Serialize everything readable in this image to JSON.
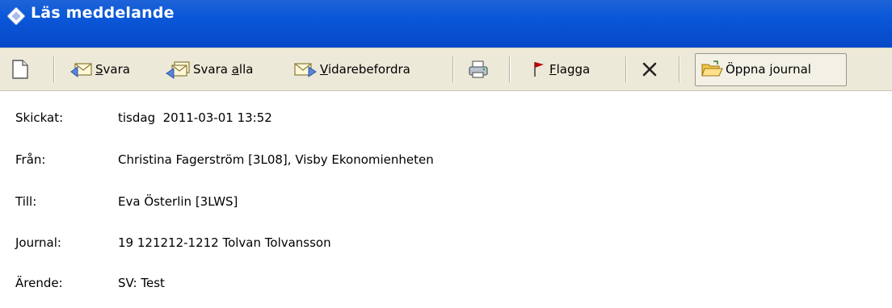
{
  "window": {
    "title": "Läs meddelande"
  },
  "toolbar": {
    "reply": {
      "underline": "S",
      "rest": "vara"
    },
    "reply_all": {
      "pre": "Svara ",
      "underline": "a",
      "rest": "lla"
    },
    "forward": {
      "underline": "V",
      "rest": "idarebefordra"
    },
    "flag": {
      "underline": "F",
      "rest": "lagga"
    },
    "open_journal": "Öppna journal"
  },
  "fields": [
    {
      "label": "Skickat:",
      "value": "tisdag  2011-03-01 13:52"
    },
    {
      "label": "Från:",
      "value": "Christina Fagerström [3L08], Visby Ekonomienheten"
    },
    {
      "label": "Till:",
      "value": "Eva Österlin [3LWS]"
    },
    {
      "label": "Journal:",
      "value": "19 121212-1212 Tolvan Tolvansson"
    },
    {
      "label": "Ärende:",
      "value": "SV: Test"
    }
  ],
  "colors": {
    "titlebar": "#0a58d9",
    "toolbar": "#ece9d8",
    "flag": "#c00000"
  }
}
